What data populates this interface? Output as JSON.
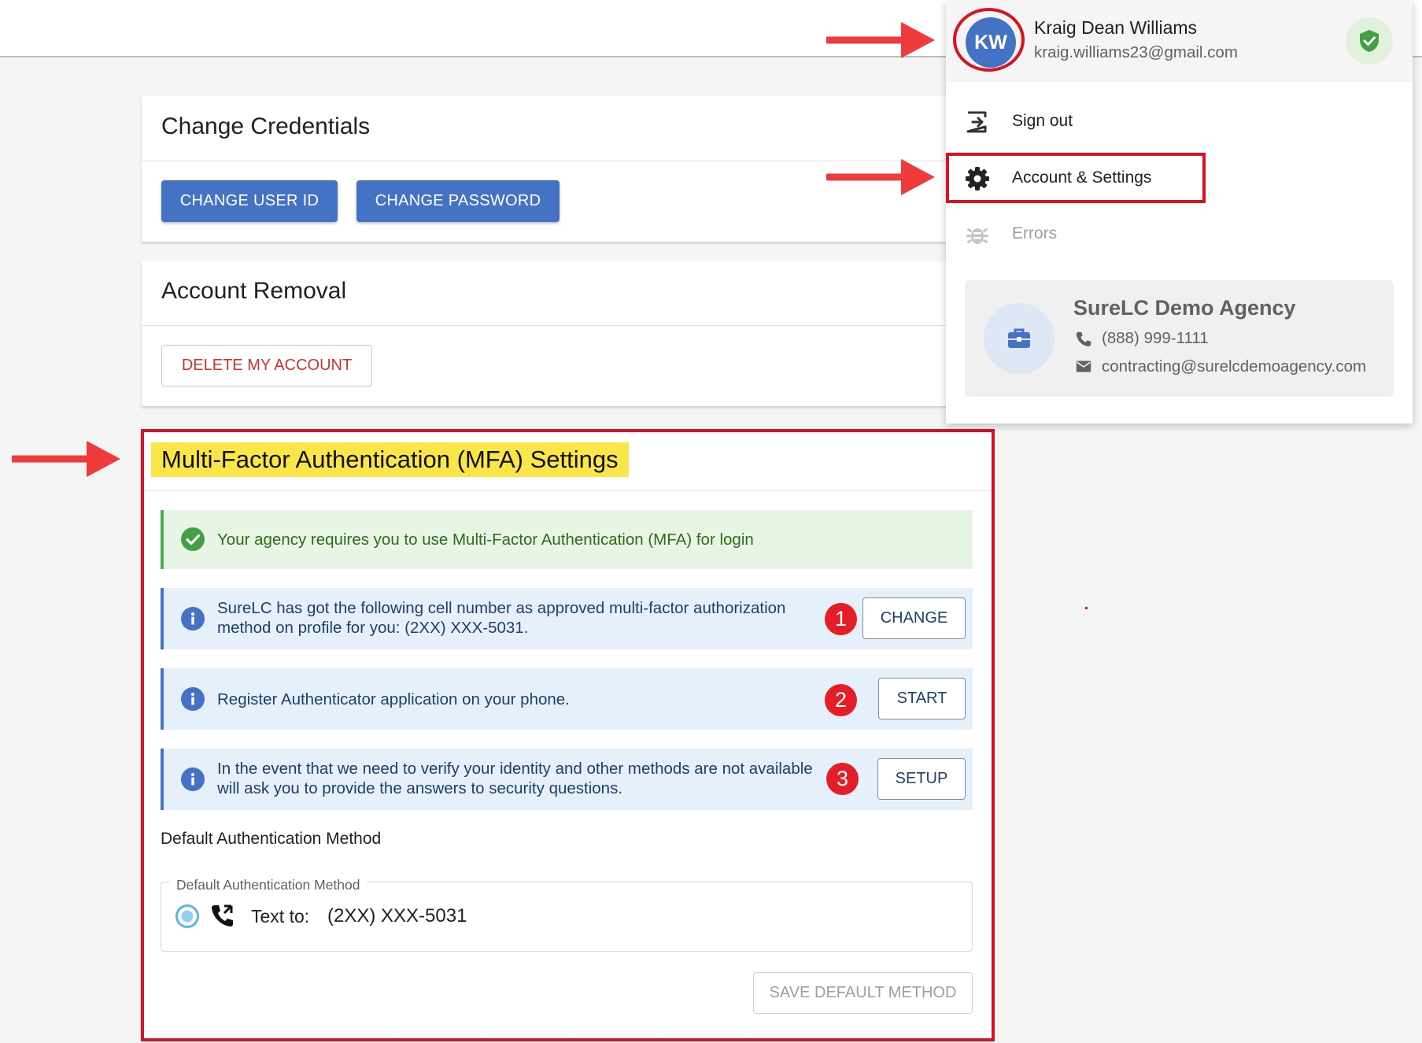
{
  "credentials": {
    "title": "Change Credentials",
    "change_user_id": "CHANGE USER ID",
    "change_password": "CHANGE PASSWORD"
  },
  "removal": {
    "title": "Account Removal",
    "delete_account": "DELETE MY ACCOUNT"
  },
  "mfa": {
    "title": "Multi-Factor Authentication (MFA) Settings",
    "requirement_notice": "Your agency requires you to use Multi-Factor Authentication (MFA) for login",
    "items": [
      {
        "step": "1",
        "text_line1": "SureLC has got the following cell number as approved multi-factor authorization",
        "text_line2": "method on profile for you: (2XX) XXX-5031.",
        "button": "CHANGE"
      },
      {
        "step": "2",
        "text_line1": "Register Authenticator application on your phone.",
        "button": "START"
      },
      {
        "step": "3",
        "text_line1": "In the event that we need to verify your identity and other methods are not available",
        "text_line2": "will ask you to provide the answers to security questions.",
        "button": "SETUP"
      }
    ],
    "default_heading": "Default Authentication Method",
    "fieldset_legend": "Default Authentication Method",
    "option_label": "Text to:",
    "option_value": "(2XX) XXX-5031",
    "save_button": "SAVE DEFAULT METHOD"
  },
  "user_menu": {
    "avatar_initials": "KW",
    "name": "Kraig Dean Williams",
    "email": "kraig.williams23@gmail.com",
    "items": [
      {
        "label": "Sign out",
        "icon": "sign-out-icon"
      },
      {
        "label": "Account & Settings",
        "icon": "gear-icon"
      },
      {
        "label": "Errors",
        "icon": "bug-icon"
      }
    ],
    "agency": {
      "name": "SureLC Demo Agency",
      "phone": "(888) 999-1111",
      "email": "contracting@surelcdemoagency.com"
    }
  },
  "colors": {
    "primary": "#4472c4",
    "annotation_red": "#d9121f",
    "highlight_yellow": "#fbe64a",
    "success_green": "#4caf50"
  }
}
